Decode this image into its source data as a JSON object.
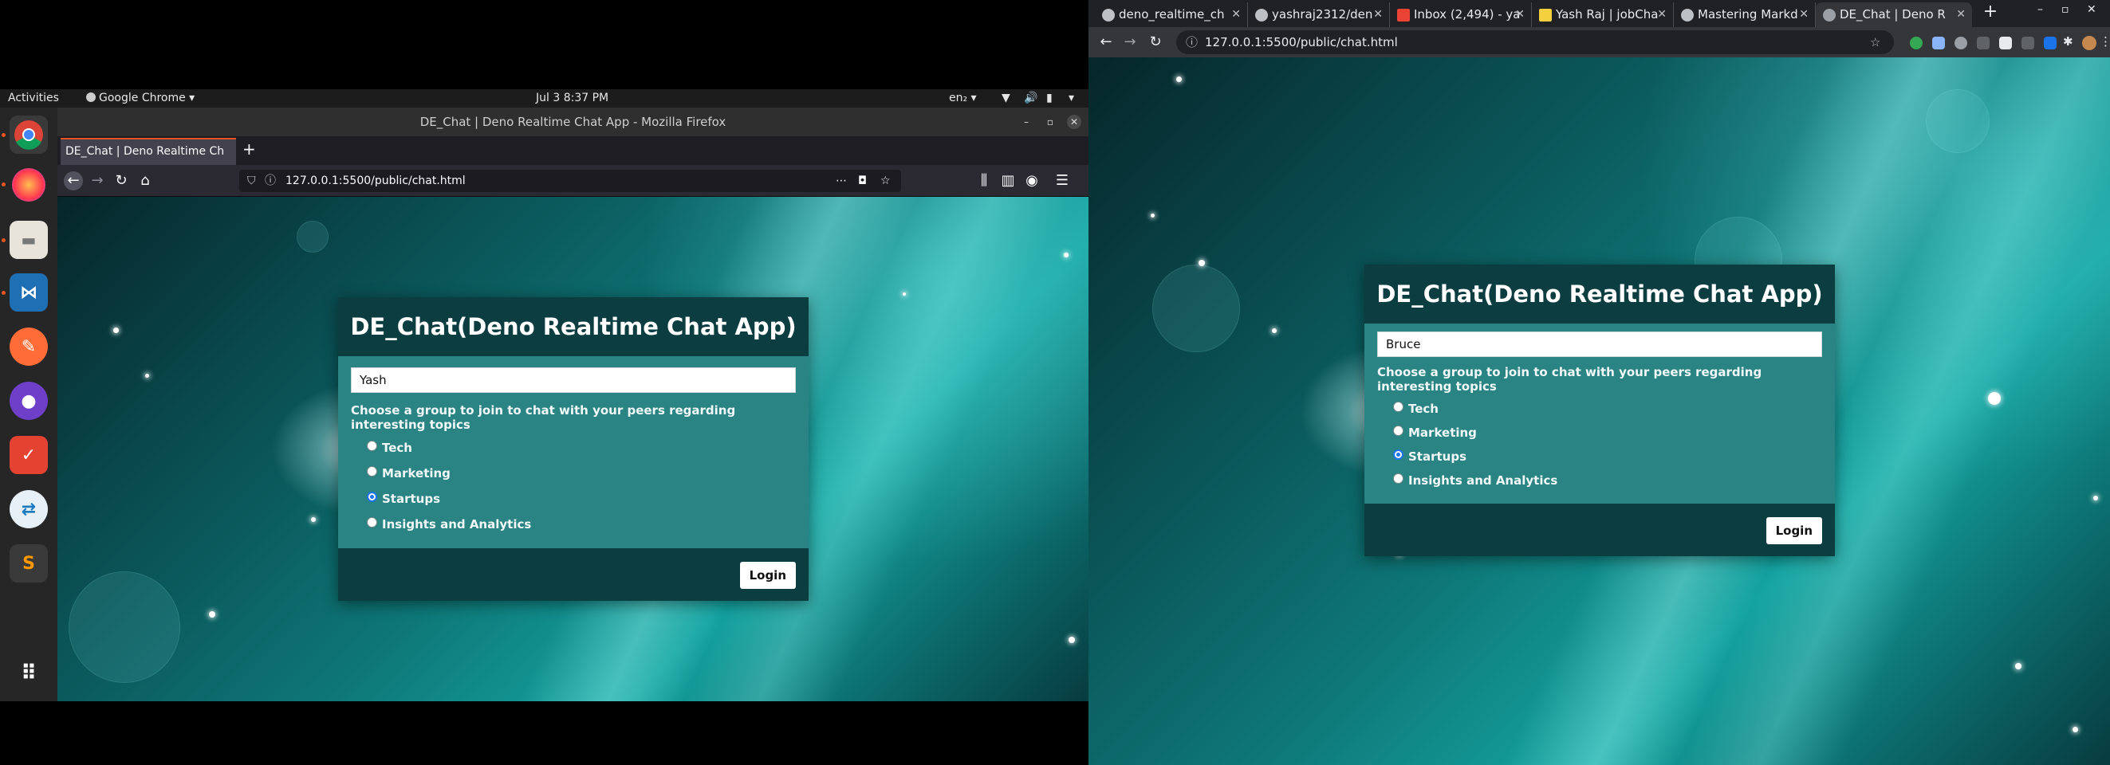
{
  "ubuntu": {
    "topbar": {
      "activities": "Activities",
      "app_menu": "Google Chrome",
      "clock": "Jul 3  8:37 PM",
      "lang": "en₂"
    },
    "dock": [
      "chrome-icon",
      "firefox-icon",
      "files-icon",
      "vscode-icon",
      "postman-icon",
      "github-desktop-icon",
      "todoist-icon",
      "remote-desktop-icon",
      "sublime-text-icon",
      "app-grid-icon"
    ]
  },
  "firefox": {
    "window_title": "DE_Chat | Deno Realtime Chat App - Mozilla Firefox",
    "tab_title": "DE_Chat | Deno Realtime Ch",
    "url": "127.0.0.1:5500/public/chat.html"
  },
  "chrome": {
    "tabs": [
      {
        "label": "deno_realtime_ch"
      },
      {
        "label": "yashraj2312/den"
      },
      {
        "label": "Inbox (2,494) - ya"
      },
      {
        "label": "Yash Raj | jobCha"
      },
      {
        "label": "Mastering Markd"
      },
      {
        "label": "DE_Chat | Deno R"
      }
    ],
    "url": "127.0.0.1:5500/public/chat.html"
  },
  "app": {
    "title": "DE_Chat(Deno Realtime Chat App)",
    "prompt": "Choose a group to join to chat with your peers regarding interesting topics",
    "options": [
      "Tech",
      "Marketing",
      "Startups",
      "Insights and Analytics"
    ],
    "login_label": "Login",
    "left_name": "Yash",
    "right_name": "Bruce",
    "left_selected": "Startups",
    "right_selected": "Startups"
  }
}
